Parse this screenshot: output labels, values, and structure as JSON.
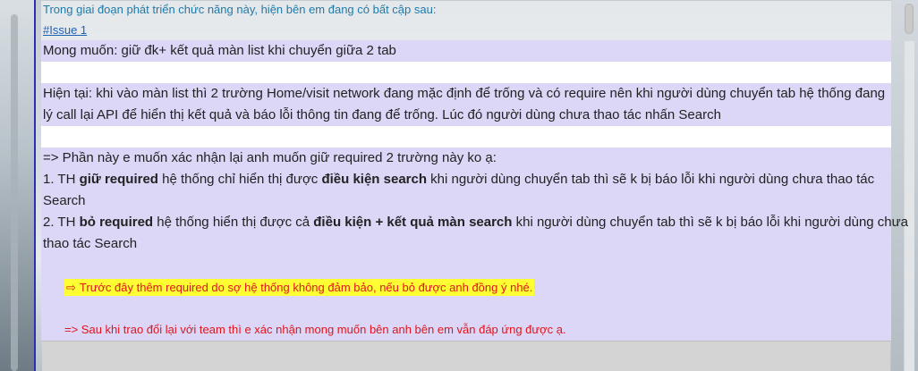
{
  "email": {
    "header": "Trong giai đoạn phát triển chức năng này, hiện bên em đang có bất cập sau:",
    "issue_link": "#Issue 1",
    "wish": "Mong muốn: giữ đk+ kết quả màn list khi chuyển giữa 2 tab",
    "current_line1": "Hiện tại: khi vào màn list thì 2 trường Home/visit network đang mặc định để trống và có require nên khi người dùng chuyển tab hệ thống đang xử",
    "current_line2": "lý call lại API để hiển thị kết quả và báo lỗi  thông tin đang để trống. Lúc đó người dùng chưa thao tác nhấn Search",
    "confirm": "=> Phần này e muốn xác nhận lại anh muốn giữ required 2 trường này ko ạ:",
    "option1": {
      "prefix": "1. TH ",
      "bold1": "giữ required",
      "mid1": " hệ thống chỉ hiển thị được ",
      "bold2": "điều kiện search",
      "suffix": " khi người dùng chuyển tab thì sẽ k bị báo lỗi khi người dùng chưa thao tác",
      "line2": "Search"
    },
    "option2": {
      "prefix": "2. TH ",
      "bold1": "bỏ required",
      "mid1": " hệ thống hiển thị được cả ",
      "bold2": "điều kiện + kết quả màn search",
      "suffix": " khi người dùng chuyển tab thì sẽ k bị báo lỗi khi người dùng chưa",
      "line2": "thao tác Search"
    },
    "note_yellow": "Trước đây thêm required do sợ hệ thống không đảm bảo, nếu bỏ được anh đồng ý nhé.",
    "note_red": "=> Sau khi trao đổi lại với team thì e xác nhận mong muốn bên anh bên em vẫn đáp ứng được ạ.",
    "arrow_icon": "⇨"
  },
  "colors": {
    "highlight": "#dcd6f7",
    "rule": "#2b2fb5",
    "note_red": "#e0151c",
    "note_yellow_bg": "#ffff33"
  }
}
